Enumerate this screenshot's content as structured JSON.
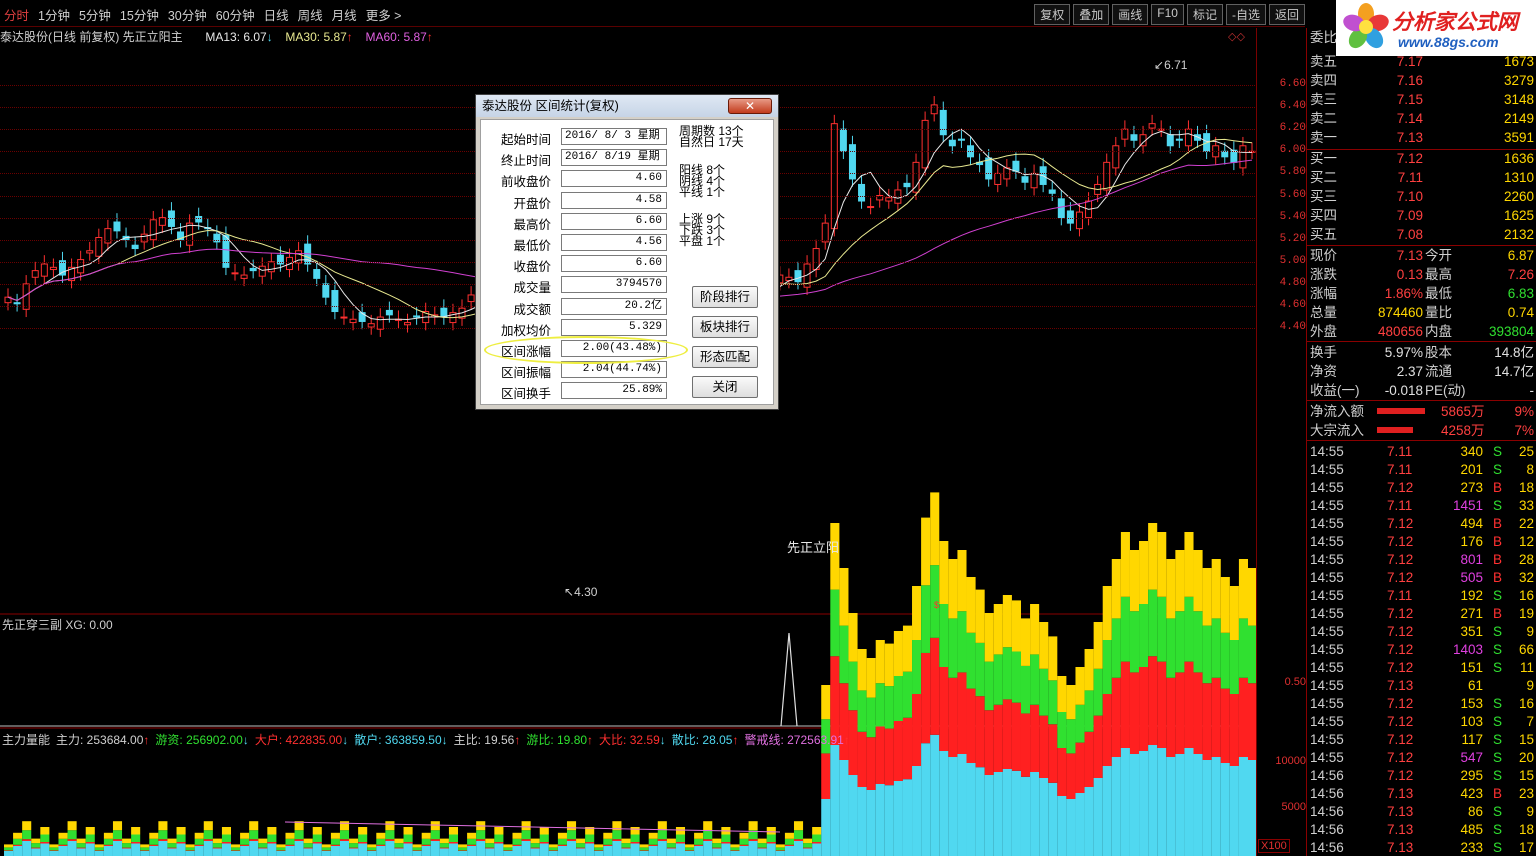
{
  "toolbar": {
    "tabs": [
      "分时",
      "1分钟",
      "5分钟",
      "15分钟",
      "30分钟",
      "60分钟",
      "日线",
      "周线",
      "月线",
      "更多 >"
    ],
    "buttons": [
      "复权",
      "叠加",
      "画线",
      "F10",
      "标记",
      "-自选",
      "返回"
    ]
  },
  "main_chart": {
    "title": "泰达股份(日线 前复权) 先正立阳主",
    "ma13": "MA13: 6.07",
    "ma30": "MA30: 5.87",
    "ma60": "MA60: 5.87",
    "y_labels": [
      "6.60",
      "6.40",
      "6.20",
      "6.00",
      "5.80",
      "5.60",
      "5.40",
      "5.20",
      "5.00",
      "4.80",
      "4.60",
      "4.40"
    ],
    "high_label": "6.71",
    "low_label": "4.30",
    "signal_label": "先正立阳",
    "colors": {
      "up": "#ff3030",
      "down": "#50d8f0",
      "ma13": "#e8e8e8",
      "ma30": "#e8e890",
      "ma60": "#d040d0",
      "grid": "#6a0000"
    }
  },
  "sub_chart": {
    "title": "先正穿三副  XG: 0.00",
    "y_label": "0.50"
  },
  "vol_chart": {
    "legend": [
      {
        "text": "主力量能",
        "color": "#d0d0d0"
      },
      {
        "text": "主力: 253684.00",
        "color": "#d0d0d0",
        "arrow": "↑"
      },
      {
        "text": "游资: 256902.00",
        "color": "#30e030",
        "arrow": "↓"
      },
      {
        "text": "大户: 422835.00",
        "color": "#ff3030",
        "arrow": "↓"
      },
      {
        "text": "散户: 363859.50",
        "color": "#50d8f0",
        "arrow": "↓"
      },
      {
        "text": "主比: 19.56",
        "color": "#d0d0d0",
        "arrow": "↑"
      },
      {
        "text": "游比: 19.80",
        "color": "#30e030",
        "arrow": "↑"
      },
      {
        "text": "大比: 32.59",
        "color": "#ff3030",
        "arrow": "↓"
      },
      {
        "text": "散比: 28.05",
        "color": "#50d8f0",
        "arrow": "↑"
      },
      {
        "text": "警戒线: 272563.91",
        "color": "#e070e0",
        "arrow": "↑"
      }
    ],
    "y_labels": [
      "10000",
      "5000"
    ],
    "unit": "X100"
  },
  "dialog": {
    "title": "泰达股份 区间统计(复权)",
    "close": "✕",
    "fields": [
      {
        "label": "起始时间",
        "value": "2016/ 8/ 3 星期"
      },
      {
        "label": "终止时间",
        "value": "2016/ 8/19 星期"
      },
      {
        "label": "前收盘价",
        "value": "4.60"
      },
      {
        "label": "开盘价",
        "value": "4.58"
      },
      {
        "label": "最高价",
        "value": "6.60"
      },
      {
        "label": "最低价",
        "value": "4.56"
      },
      {
        "label": "收盘价",
        "value": "6.60"
      },
      {
        "label": "成交量",
        "value": "3794570"
      },
      {
        "label": "成交额",
        "value": "20.2亿"
      },
      {
        "label": "加权均价",
        "value": "5.329"
      },
      {
        "label": "区间涨幅",
        "value": "2.00(43.48%)"
      },
      {
        "label": "区间振幅",
        "value": "2.04(44.74%)"
      },
      {
        "label": "区间换手",
        "value": "25.89%"
      }
    ],
    "notes": [
      "周期数 13个",
      "自然日 17天",
      "阳线 8个",
      "阴线 4个",
      "平线 1个",
      "上涨 9个",
      "下跌 3个",
      "平盘 1个"
    ],
    "buttons": [
      "阶段排行",
      "板块排行",
      "形态匹配",
      "关闭"
    ]
  },
  "logo": {
    "title": "分析家公式网",
    "url": "www.88gs.com"
  },
  "quote": {
    "header": "委比",
    "sells": [
      {
        "name": "卖五",
        "price": "7.17",
        "vol": "1673"
      },
      {
        "name": "卖四",
        "price": "7.16",
        "vol": "3279"
      },
      {
        "name": "卖三",
        "price": "7.15",
        "vol": "3148"
      },
      {
        "name": "卖二",
        "price": "7.14",
        "vol": "2149"
      },
      {
        "name": "卖一",
        "price": "7.13",
        "vol": "3591"
      }
    ],
    "buys": [
      {
        "name": "买一",
        "price": "7.12",
        "vol": "1636"
      },
      {
        "name": "买二",
        "price": "7.11",
        "vol": "1310"
      },
      {
        "name": "买三",
        "price": "7.10",
        "vol": "2260"
      },
      {
        "name": "买四",
        "price": "7.09",
        "vol": "1625"
      },
      {
        "name": "买五",
        "price": "7.08",
        "vol": "2132"
      }
    ],
    "stats": [
      {
        "a": "现价",
        "b": "7.13",
        "bc": "#ff4040",
        "c": "今开",
        "d": "6.87",
        "dc": "#ffd700"
      },
      {
        "a": "涨跌",
        "b": "0.13",
        "bc": "#ff4040",
        "c": "最高",
        "d": "7.26",
        "dc": "#ff4040"
      },
      {
        "a": "涨幅",
        "b": "1.86%",
        "bc": "#ff4040",
        "c": "最低",
        "d": "6.83",
        "dc": "#30e030"
      },
      {
        "a": "总量",
        "b": "874460",
        "bc": "#ffd700",
        "c": "量比",
        "d": "0.74",
        "dc": "#ffd700"
      },
      {
        "a": "外盘",
        "b": "480656",
        "bc": "#ff4040",
        "c": "内盘",
        "d": "393804",
        "dc": "#30e030"
      },
      {
        "a": "换手",
        "b": "5.97%",
        "bc": "#e0e0e0",
        "c": "股本",
        "d": "14.8亿",
        "dc": "#e0e0e0"
      },
      {
        "a": "净资",
        "b": "2.37",
        "bc": "#e0e0e0",
        "c": "流通",
        "d": "14.7亿",
        "dc": "#e0e0e0"
      },
      {
        "a": "收益(一)",
        "b": "-0.018",
        "bc": "#e0e0e0",
        "c": "PE(动)",
        "d": "-",
        "dc": "#e0e0e0"
      }
    ],
    "flows": [
      {
        "a": "净流入额",
        "b": "5865万",
        "c": "9%"
      },
      {
        "a": "大宗流入",
        "b": "4258万",
        "c": "7%"
      }
    ],
    "ticks": [
      {
        "t": "14:55",
        "p": "7.11",
        "v": "340",
        "s": "S",
        "n": "25"
      },
      {
        "t": "14:55",
        "p": "7.11",
        "v": "201",
        "s": "S",
        "n": "8"
      },
      {
        "t": "14:55",
        "p": "7.12",
        "v": "273",
        "s": "B",
        "n": "18"
      },
      {
        "t": "14:55",
        "p": "7.11",
        "v": "1451",
        "s": "S",
        "n": "33",
        "vc": "#e040e0"
      },
      {
        "t": "14:55",
        "p": "7.12",
        "v": "494",
        "s": "B",
        "n": "22"
      },
      {
        "t": "14:55",
        "p": "7.12",
        "v": "176",
        "s": "B",
        "n": "12"
      },
      {
        "t": "14:55",
        "p": "7.12",
        "v": "801",
        "s": "B",
        "n": "28",
        "vc": "#e040e0"
      },
      {
        "t": "14:55",
        "p": "7.12",
        "v": "505",
        "s": "B",
        "n": "32",
        "vc": "#e040e0"
      },
      {
        "t": "14:55",
        "p": "7.11",
        "v": "192",
        "s": "S",
        "n": "16"
      },
      {
        "t": "14:55",
        "p": "7.12",
        "v": "271",
        "s": "B",
        "n": "19"
      },
      {
        "t": "14:55",
        "p": "7.12",
        "v": "351",
        "s": "S",
        "n": "9"
      },
      {
        "t": "14:55",
        "p": "7.12",
        "v": "1403",
        "s": "S",
        "n": "66",
        "vc": "#e040e0"
      },
      {
        "t": "14:55",
        "p": "7.12",
        "v": "151",
        "s": "S",
        "n": "11"
      },
      {
        "t": "14:55",
        "p": "7.13",
        "v": "61",
        "s": "",
        "n": "9"
      },
      {
        "t": "14:55",
        "p": "7.12",
        "v": "153",
        "s": "S",
        "n": "16"
      },
      {
        "t": "14:55",
        "p": "7.12",
        "v": "103",
        "s": "S",
        "n": "7"
      },
      {
        "t": "14:55",
        "p": "7.12",
        "v": "117",
        "s": "S",
        "n": "15"
      },
      {
        "t": "14:55",
        "p": "7.12",
        "v": "547",
        "s": "S",
        "n": "20",
        "vc": "#e040e0"
      },
      {
        "t": "14:56",
        "p": "7.12",
        "v": "295",
        "s": "S",
        "n": "15"
      },
      {
        "t": "14:56",
        "p": "7.13",
        "v": "423",
        "s": "B",
        "n": "23"
      },
      {
        "t": "14:56",
        "p": "7.13",
        "v": "86",
        "s": "S",
        "n": "9"
      },
      {
        "t": "14:56",
        "p": "7.13",
        "v": "485",
        "s": "S",
        "n": "18"
      },
      {
        "t": "14:56",
        "p": "7.13",
        "v": "233",
        "s": "S",
        "n": "17"
      }
    ]
  }
}
